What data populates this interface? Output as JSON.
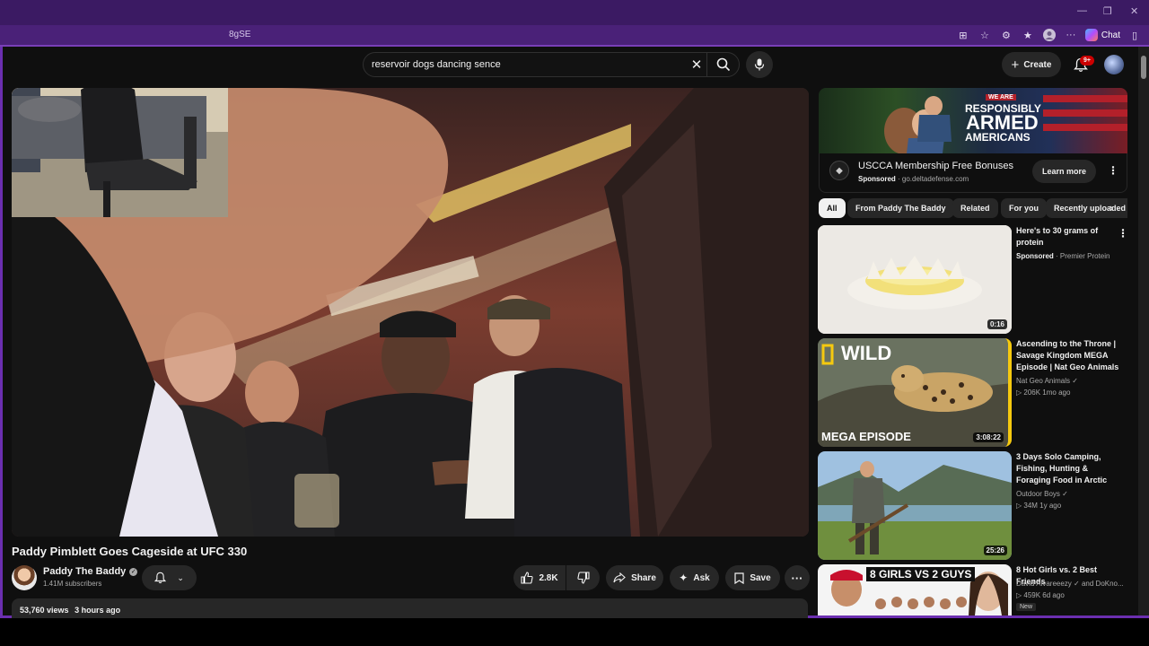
{
  "browser": {
    "url_fragment": "8gSE",
    "chat_label": "Chat",
    "window_controls": [
      "—",
      "❐",
      "✕"
    ]
  },
  "header": {
    "search_query": "reservoir dogs dancing sence",
    "create_label": "Create",
    "notification_count": "9+"
  },
  "video": {
    "title": "Paddy Pimblett Goes Cageside at UFC 330",
    "channel_name": "Paddy The Baddy",
    "subscribers": "1.41M subscribers",
    "like_count": "2.8K",
    "share_label": "Share",
    "ask_label": "Ask",
    "save_label": "Save",
    "views": "53,760 views",
    "uploaded": "3 hours ago"
  },
  "ad": {
    "banner_line1": "WE ARE",
    "banner_line2": "RESPONSIBLY",
    "banner_line3": "ARMED",
    "banner_line4": "AMERICANS",
    "title": "USCCA Membership Free Bonuses",
    "sponsored": "Sponsored",
    "domain": "go.deltadefense.com",
    "cta": "Learn more"
  },
  "chips": [
    "All",
    "From Paddy The Baddy",
    "Related",
    "For you",
    "Recently uploaded"
  ],
  "recommendations": [
    {
      "title": "Here's to 30 grams of protein",
      "line1": "Sponsored",
      "line1_rest": " · Premier Protein",
      "line2": "",
      "duration": "0:16",
      "verified": false,
      "is_new": false
    },
    {
      "title": "Ascending to the Throne | Savage Kingdom MEGA Episode | Nat Geo Animals",
      "line1": "Nat Geo Animals",
      "line1_rest": "",
      "line2": "206K  1mo ago",
      "duration": "3:08:22",
      "verified": true,
      "is_new": false,
      "thumb_text_top": "WILD",
      "thumb_text_bottom": "MEGA EPISODE"
    },
    {
      "title": "3 Days Solo Camping, Fishing, Hunting & Foraging Food in Arctic",
      "line1": "Outdoor Boys",
      "line1_rest": "",
      "line2": "34M  1y ago",
      "duration": "25:26",
      "verified": true,
      "is_new": false
    },
    {
      "title": "8 Hot Girls vs. 2 Best Friends",
      "line1": "David Alvareeezy",
      "line1_rest": " and DoKno...",
      "line2": "459K  6d ago",
      "duration": "",
      "verified": true,
      "is_new": true,
      "new_label": "New",
      "thumb_text_top": "8 GIRLS VS 2 GUYS"
    }
  ],
  "colors": {
    "background": "#0f0f0f",
    "surface": "#272727",
    "browser_frame": "#4a2178",
    "accent_red": "#cc0000"
  }
}
